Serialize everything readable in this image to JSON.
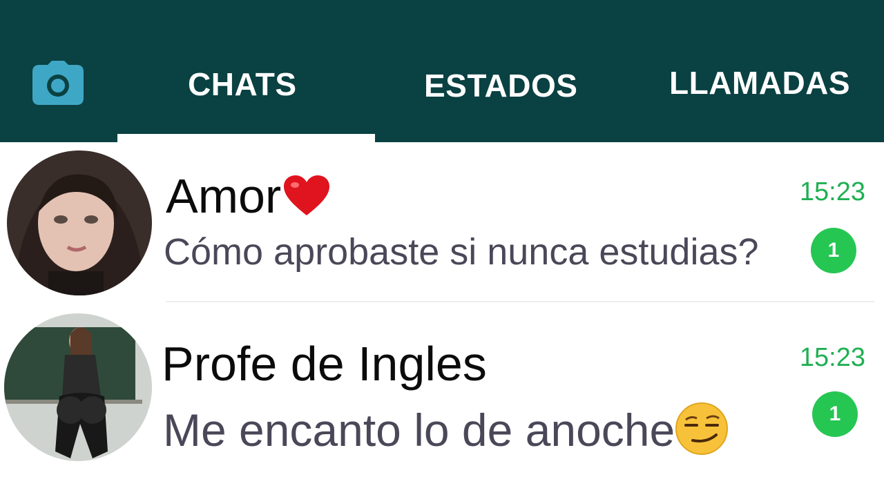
{
  "header": {
    "tabs": [
      {
        "label": "CHATS",
        "active": true
      },
      {
        "label": "ESTADOS",
        "active": false
      },
      {
        "label": "LLAMADAS",
        "active": false
      }
    ],
    "camera_icon": "camera-icon"
  },
  "chats": [
    {
      "name": "Amor",
      "name_emoji": "heart-icon",
      "message": "Cómo aprobaste si nunca estudias?",
      "time": "15:23",
      "unread": "1",
      "avatar": "avatar-photo"
    },
    {
      "name": "Profe de Ingles",
      "message": "Me encanto lo de anoche",
      "message_emoji": "smirk-emoji-icon",
      "time": "15:23",
      "unread": "1",
      "avatar": "avatar-photo"
    }
  ],
  "colors": {
    "header_bg": "#0a4142",
    "camera": "#3fa7c6",
    "time": "#1faf53",
    "badge": "#26c653",
    "message_text": "#4a4858"
  }
}
